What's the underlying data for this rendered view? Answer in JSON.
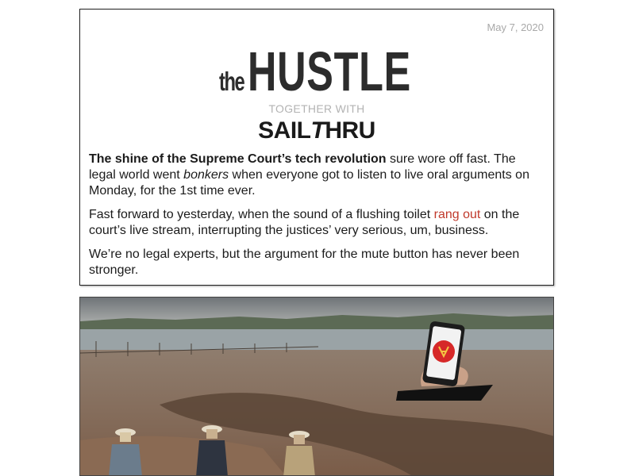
{
  "newsletter": {
    "date": "May 7, 2020",
    "logo_prefix": "the",
    "logo_name": "HUSTLE",
    "together_with": "TOGETHER WITH",
    "sponsor_part1": "SAIL",
    "sponsor_part2": "T",
    "sponsor_part3": "HRU"
  },
  "article": {
    "p1_bold": "The shine of the Supreme Court’s tech revolution",
    "p1_rest1": " sure wore off fast. The legal world went ",
    "p1_italic": "bonkers",
    "p1_rest2": " when everyone got to listen to live oral arguments on Monday, for the 1st time ever.",
    "p2_part1": "Fast forward to yesterday, when the sound of a flushing toilet ",
    "p2_link": "rang out",
    "p2_part2": " on the court’s live stream, interrupting the justices’ very serious, um, business.",
    "p3": "We’re no legal experts, but the argument for the mute button has never been stronger."
  },
  "colors": {
    "link": "#c0392b",
    "date_gray": "#a9a9a9",
    "logo_dark": "#2c2c2c",
    "phone_badge": "#d62828"
  },
  "hero_image": {
    "icon": "phone-with-red-badge-icon"
  }
}
